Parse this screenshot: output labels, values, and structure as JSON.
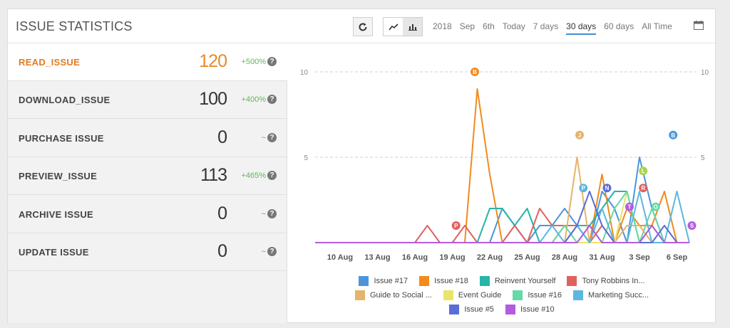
{
  "header": {
    "title": "ISSUE STATISTICS",
    "ranges": [
      "2018",
      "Sep",
      "6th",
      "Today",
      "7 days",
      "30 days",
      "60 days",
      "All Time"
    ],
    "active_range": "30 days"
  },
  "metrics": [
    {
      "label": "READ_ISSUE",
      "value": "120",
      "change": "+500%",
      "active": true
    },
    {
      "label": "DOWNLOAD_ISSUE",
      "value": "100",
      "change": "+400%"
    },
    {
      "label": "PURCHASE ISSUE",
      "value": "0",
      "change": "~"
    },
    {
      "label": "PREVIEW_ISSUE",
      "value": "113",
      "change": "+465%"
    },
    {
      "label": "ARCHIVE ISSUE",
      "value": "0",
      "change": "~"
    },
    {
      "label": "UPDATE ISSUE",
      "value": "0",
      "change": "~"
    }
  ],
  "icons": {
    "refresh": "refresh-icon",
    "line": "line-chart-icon",
    "bar": "bar-chart-icon",
    "calendar": "calendar-icon",
    "help": "help-icon"
  },
  "chart_data": {
    "type": "line",
    "ylim": [
      0,
      10
    ],
    "yticks": [
      5,
      10
    ],
    "x_tick_labels": [
      "10 Aug",
      "13 Aug",
      "16 Aug",
      "19 Aug",
      "22 Aug",
      "25 Aug",
      "28 Aug",
      "31 Aug",
      "3 Sep",
      "6 Sep"
    ],
    "x_tick_days": [
      2,
      5,
      8,
      11,
      14,
      17,
      20,
      23,
      26,
      29
    ],
    "x_days": [
      0,
      1,
      2,
      3,
      4,
      5,
      6,
      7,
      8,
      9,
      10,
      11,
      12,
      13,
      14,
      15,
      16,
      17,
      18,
      19,
      20,
      21,
      22,
      23,
      24,
      25,
      26,
      27,
      28,
      29,
      30
    ],
    "series": [
      {
        "name": "Issue #17",
        "color": "#4d95db",
        "values": [
          0,
          0,
          0,
          0,
          0,
          0,
          0,
          0,
          0,
          0,
          0,
          0,
          0,
          0,
          0,
          2,
          1,
          0,
          1,
          1,
          2,
          1,
          0,
          3,
          2,
          0,
          5,
          2,
          0,
          0,
          0
        ]
      },
      {
        "name": "Issue #18",
        "color": "#f28a1c",
        "values": [
          0,
          0,
          0,
          0,
          0,
          0,
          0,
          0,
          0,
          0,
          0,
          0,
          0,
          9,
          4,
          0,
          0,
          0,
          0,
          0,
          0,
          1,
          0,
          4,
          0,
          2,
          1,
          1,
          3,
          0,
          0
        ]
      },
      {
        "name": "Reinvent Yourself",
        "color": "#26b5a6",
        "values": [
          0,
          0,
          0,
          0,
          0,
          0,
          0,
          0,
          0,
          0,
          0,
          0,
          0,
          0,
          2,
          2,
          1,
          2,
          0,
          0,
          1,
          1,
          1,
          2,
          3,
          3,
          0,
          1,
          0,
          0,
          0
        ]
      },
      {
        "name": "Tony Robbins In...",
        "color": "#e0625e",
        "values": [
          0,
          0,
          0,
          0,
          0,
          0,
          0,
          0,
          0,
          1,
          0,
          0,
          1,
          0,
          0,
          0,
          1,
          0,
          2,
          1,
          1,
          1,
          0,
          1,
          0,
          0,
          0,
          0,
          0,
          0,
          0
        ]
      },
      {
        "name": "Guide to Social ...",
        "color": "#e6b46a",
        "values": [
          0,
          0,
          0,
          0,
          0,
          0,
          0,
          0,
          0,
          0,
          0,
          0,
          0,
          0,
          0,
          0,
          0,
          0,
          0,
          0,
          0,
          5,
          0,
          0,
          0,
          1,
          1,
          0,
          0,
          0,
          0
        ]
      },
      {
        "name": "Event Guide",
        "color": "#ece46a",
        "values": [
          0,
          0,
          0,
          0,
          0,
          0,
          0,
          0,
          0,
          0,
          0,
          0,
          0,
          0,
          0,
          0,
          0,
          0,
          0,
          0,
          1,
          0,
          0,
          0,
          0,
          3,
          0,
          0,
          0,
          0,
          0
        ]
      },
      {
        "name": "Issue #16",
        "color": "#66d9a8",
        "values": [
          0,
          0,
          0,
          0,
          0,
          0,
          0,
          0,
          0,
          0,
          0,
          0,
          0,
          0,
          0,
          0,
          0,
          0,
          0,
          0,
          1,
          0,
          1,
          0,
          2,
          3,
          0,
          2,
          0,
          0,
          0
        ]
      },
      {
        "name": "Marketing Succ...",
        "color": "#5bb8e0",
        "values": [
          0,
          0,
          0,
          0,
          0,
          0,
          0,
          0,
          0,
          0,
          0,
          0,
          0,
          0,
          0,
          0,
          0,
          0,
          0,
          1,
          0,
          1,
          0,
          2,
          0,
          0,
          3,
          0,
          0,
          3,
          0
        ]
      },
      {
        "name": "Issue #5",
        "color": "#5b6dd8",
        "values": [
          0,
          0,
          0,
          0,
          0,
          0,
          0,
          0,
          0,
          0,
          0,
          0,
          0,
          0,
          0,
          0,
          0,
          0,
          0,
          0,
          0,
          1,
          3,
          1,
          0,
          0,
          0,
          0,
          1,
          0,
          0
        ]
      },
      {
        "name": "Issue #10",
        "color": "#b35ce0",
        "values": [
          0,
          0,
          0,
          0,
          0,
          0,
          0,
          0,
          0,
          0,
          0,
          0,
          0,
          0,
          0,
          0,
          0,
          0,
          0,
          0,
          0,
          0,
          1,
          0,
          0,
          0,
          0,
          1,
          0,
          0,
          0
        ]
      }
    ],
    "markers": [
      {
        "letter": "B",
        "day": 12.8,
        "value": 10,
        "color": "#f28a1c"
      },
      {
        "letter": "P",
        "day": 11.3,
        "value": 1,
        "color": "#e0625e"
      },
      {
        "letter": "J",
        "day": 21.2,
        "value": 6.3,
        "color": "#e6b46a"
      },
      {
        "letter": "P",
        "day": 21.5,
        "value": 3.2,
        "color": "#5bb8e0"
      },
      {
        "letter": "N",
        "day": 23.4,
        "value": 3.2,
        "color": "#5b6dd8"
      },
      {
        "letter": "L",
        "day": 26.3,
        "value": 4.2,
        "color": "#a8d44f"
      },
      {
        "letter": "R",
        "day": 26.3,
        "value": 3.2,
        "color": "#e0625e"
      },
      {
        "letter": "T",
        "day": 25.2,
        "value": 2.1,
        "color": "#b35ce0"
      },
      {
        "letter": "O",
        "day": 27.3,
        "value": 2.1,
        "color": "#66d9a8"
      },
      {
        "letter": "B",
        "day": 28.7,
        "value": 6.3,
        "color": "#4d95db"
      },
      {
        "letter": "S",
        "day": 30.2,
        "value": 1,
        "color": "#b35ce0"
      }
    ]
  }
}
